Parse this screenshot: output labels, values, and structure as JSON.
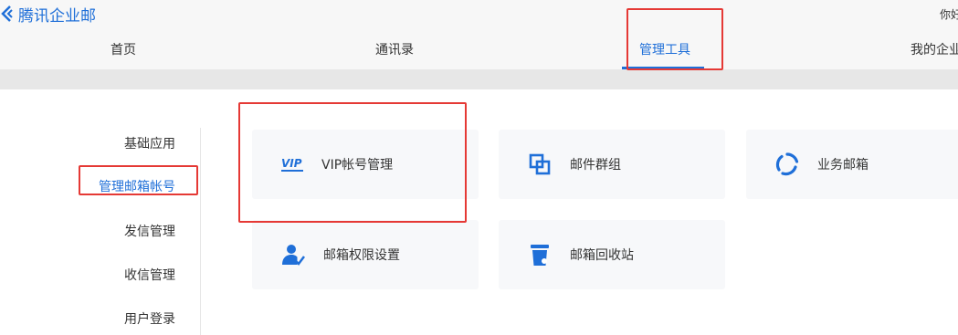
{
  "header": {
    "brand": "腾讯企业邮",
    "greeting": "你好"
  },
  "nav": {
    "items": [
      {
        "label": "首页"
      },
      {
        "label": "通讯录"
      },
      {
        "label": "管理工具",
        "active": true
      },
      {
        "label": "我的企业"
      }
    ]
  },
  "sidebar": {
    "items": [
      {
        "label": "基础应用"
      },
      {
        "label": "管理邮箱帐号",
        "active": true
      },
      {
        "label": "发信管理"
      },
      {
        "label": "收信管理"
      },
      {
        "label": "用户登录"
      }
    ]
  },
  "tools": {
    "vip": {
      "label": "VIP帐号管理",
      "icon_text": "VIP"
    },
    "group": {
      "label": "邮件群组"
    },
    "business": {
      "label": "业务邮箱"
    },
    "permission": {
      "label": "邮箱权限设置"
    },
    "recycle": {
      "label": "邮箱回收站"
    }
  },
  "colors": {
    "accent": "#1f6fd8",
    "highlight": "#e53935"
  },
  "icons": [
    "brand-logo-icon",
    "vip-icon",
    "group-icon",
    "business-mailbox-icon",
    "permission-icon",
    "recycle-bin-icon"
  ]
}
